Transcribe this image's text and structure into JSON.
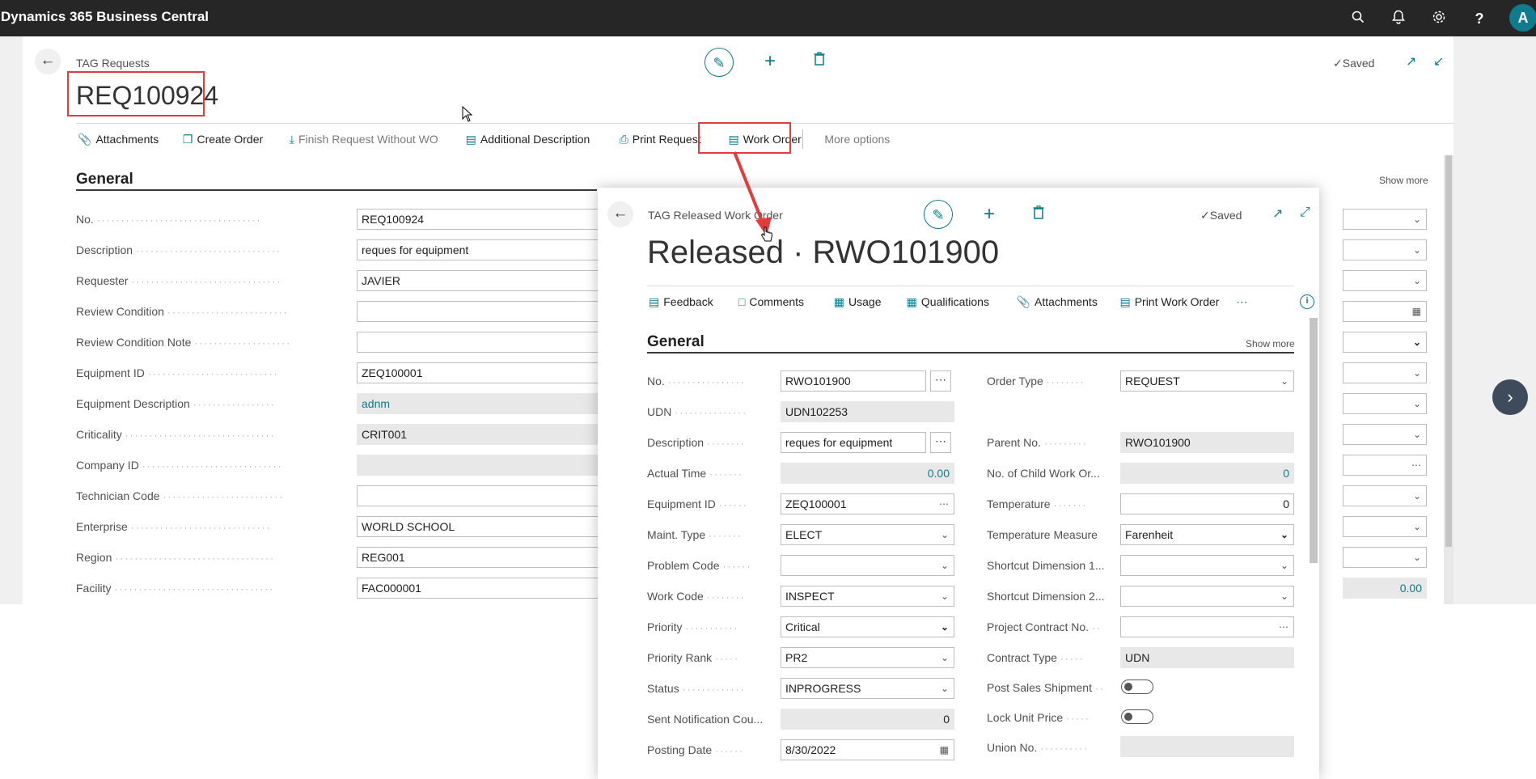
{
  "app": {
    "title": "Dynamics 365 Business Central",
    "avatar_letter": "A"
  },
  "main": {
    "breadcrumb": "TAG Requests",
    "title": "REQ100924",
    "saved": "Saved",
    "actions": [
      "Attachments",
      "Create Order",
      "Finish Request Without WO",
      "Additional Description",
      "Print Request",
      "Work Order",
      "More options"
    ],
    "section": "General",
    "show_more": "Show more",
    "fields": [
      {
        "label": "No.",
        "value": "REQ100924"
      },
      {
        "label": "Description",
        "value": "reques for equipment"
      },
      {
        "label": "Requester",
        "value": "JAVIER"
      },
      {
        "label": "Review Condition",
        "value": ""
      },
      {
        "label": "Review Condition Note",
        "value": ""
      },
      {
        "label": "Equipment ID",
        "value": "ZEQ100001"
      },
      {
        "label": "Equipment Description",
        "value": "adnm"
      },
      {
        "label": "Criticality",
        "value": "CRIT001"
      },
      {
        "label": "Company ID",
        "value": ""
      },
      {
        "label": "Technician Code",
        "value": ""
      },
      {
        "label": "Enterprise",
        "value": "WORLD SCHOOL"
      },
      {
        "label": "Region",
        "value": "REG001"
      },
      {
        "label": "Facility",
        "value": "FAC000001"
      }
    ],
    "right_column_last_value": "0.00"
  },
  "dialog": {
    "breadcrumb": "TAG Released Work Order",
    "title": "Released · RWO101900",
    "saved": "Saved",
    "actions": [
      "Feedback",
      "Comments",
      "Usage",
      "Qualifications",
      "Attachments",
      "Print Work Order"
    ],
    "section": "General",
    "show_more": "Show more",
    "left_fields": [
      {
        "label": "No.",
        "value": "RWO101900"
      },
      {
        "label": "UDN",
        "value": "UDN102253"
      },
      {
        "label": "Description",
        "value": "reques for equipment"
      },
      {
        "label": "Actual Time",
        "value": "0.00"
      },
      {
        "label": "Equipment ID",
        "value": "ZEQ100001"
      },
      {
        "label": "Maint. Type",
        "value": "ELECT"
      },
      {
        "label": "Problem Code",
        "value": ""
      },
      {
        "label": "Work Code",
        "value": "INSPECT"
      },
      {
        "label": "Priority",
        "value": "Critical"
      },
      {
        "label": "Priority Rank",
        "value": "PR2"
      },
      {
        "label": "Status",
        "value": "INPROGRESS"
      },
      {
        "label": "Sent Notification Cou...",
        "value": "0"
      },
      {
        "label": "Posting Date",
        "value": "8/30/2022"
      }
    ],
    "right_fields": [
      {
        "label": "Order Type",
        "value": "REQUEST"
      },
      {
        "label": "Parent No.",
        "value": "RWO101900"
      },
      {
        "label": "No. of Child Work Or...",
        "value": "0"
      },
      {
        "label": "Temperature",
        "value": "0"
      },
      {
        "label": "Temperature Measure",
        "value": "Farenheit"
      },
      {
        "label": "Shortcut Dimension 1...",
        "value": ""
      },
      {
        "label": "Shortcut Dimension 2...",
        "value": ""
      },
      {
        "label": "Project Contract No.",
        "value": ""
      },
      {
        "label": "Contract Type",
        "value": "UDN"
      },
      {
        "label": "Post Sales Shipment",
        "value": ""
      },
      {
        "label": "Lock Unit Price",
        "value": ""
      },
      {
        "label": "Union No.",
        "value": ""
      }
    ]
  },
  "colors": {
    "accent": "#0f7b8c",
    "highlight": "#e23c3c",
    "appbar": "#262626"
  }
}
